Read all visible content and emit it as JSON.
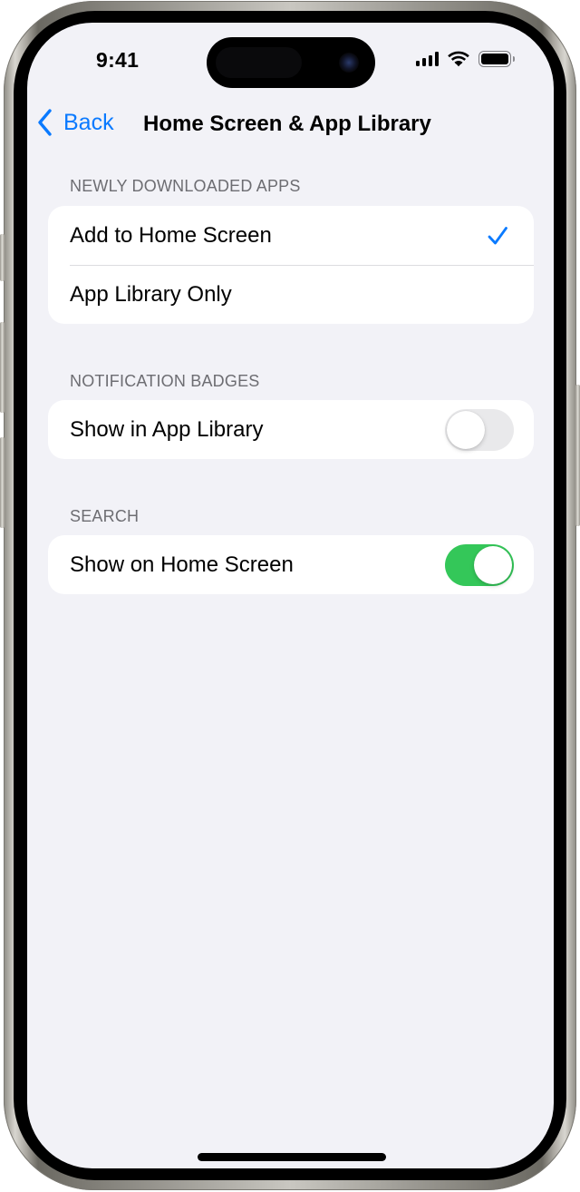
{
  "status_bar": {
    "time": "9:41",
    "icons": [
      "cellular-signal-icon",
      "wifi-icon",
      "battery-icon"
    ],
    "signal_bars": 4,
    "battery_level_percent": 100
  },
  "nav": {
    "back_label": "Back",
    "title": "Home Screen & App Library"
  },
  "sections": [
    {
      "header": "NEWLY DOWNLOADED APPS",
      "rows": [
        {
          "label": "Add to Home Screen",
          "selected": true
        },
        {
          "label": "App Library Only",
          "selected": false
        }
      ]
    },
    {
      "header": "NOTIFICATION BADGES",
      "rows": [
        {
          "label": "Show in App Library",
          "toggle": false
        }
      ]
    },
    {
      "header": "SEARCH",
      "rows": [
        {
          "label": "Show on Home Screen",
          "toggle": true
        }
      ]
    }
  ],
  "colors": {
    "accent": "#0a7aff",
    "toggle_on": "#34c759",
    "toggle_off": "#e9e9eb",
    "background": "#f2f2f7",
    "section_header": "#6d6d72"
  }
}
